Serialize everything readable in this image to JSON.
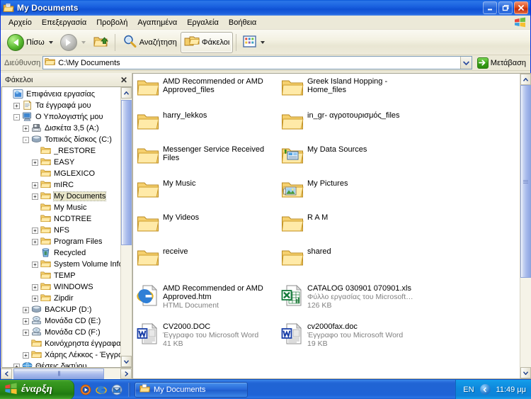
{
  "window": {
    "title": "My Documents",
    "icon": "folder-documents-icon",
    "buttons": {
      "minimize": "Ελαχιστοποίηση",
      "maximize": "Μεγιστοποίηση",
      "close": "Κλείσιμο"
    }
  },
  "menu": {
    "items": [
      {
        "label": "Αρχείο"
      },
      {
        "label": "Επεξεργασία"
      },
      {
        "label": "Προβολή"
      },
      {
        "label": "Αγαπημένα"
      },
      {
        "label": "Εργαλεία"
      },
      {
        "label": "Βοήθεια"
      }
    ],
    "flag_icon": "windows-flag-icon"
  },
  "toolbar": {
    "back_label": "Πίσω",
    "forward_label": "",
    "up_label": "",
    "search_label": "Αναζήτηση",
    "folders_label": "Φάκελοι",
    "views_label": ""
  },
  "address": {
    "label": "Διεύθυνση",
    "value": "C:\\My Documents",
    "go_label": "Μετάβαση"
  },
  "folders_pane": {
    "header": "Φάκελοι",
    "close_glyph": "✕",
    "tree": [
      {
        "label": "Επιφάνεια εργασίας",
        "indent": 0,
        "expander": "none",
        "icon": "desktop-icon",
        "selected": false
      },
      {
        "label": "Τα έγγραφά μου",
        "indent": 1,
        "expander": "+",
        "icon": "my-documents-icon",
        "selected": false
      },
      {
        "label": "Ο Υπολογιστής μου",
        "indent": 1,
        "expander": "-",
        "icon": "my-computer-icon",
        "selected": false
      },
      {
        "label": "Δισκέτα 3,5 (A:)",
        "indent": 2,
        "expander": "+",
        "icon": "floppy-icon",
        "selected": false
      },
      {
        "label": "Τοπικός δίσκος (C:)",
        "indent": 2,
        "expander": "-",
        "icon": "harddisk-icon",
        "selected": false
      },
      {
        "label": "_RESTORE",
        "indent": 3,
        "expander": "none",
        "icon": "folder-icon",
        "selected": false
      },
      {
        "label": "EASY",
        "indent": 3,
        "expander": "+",
        "icon": "folder-icon",
        "selected": false
      },
      {
        "label": "MGLEXICO",
        "indent": 3,
        "expander": "none",
        "icon": "folder-icon",
        "selected": false
      },
      {
        "label": "mIRC",
        "indent": 3,
        "expander": "+",
        "icon": "folder-icon",
        "selected": false
      },
      {
        "label": "My Documents",
        "indent": 3,
        "expander": "+",
        "icon": "folder-icon",
        "selected": true
      },
      {
        "label": "My Music",
        "indent": 3,
        "expander": "none",
        "icon": "folder-icon",
        "selected": false
      },
      {
        "label": "NCDTREE",
        "indent": 3,
        "expander": "none",
        "icon": "folder-icon",
        "selected": false
      },
      {
        "label": "NFS",
        "indent": 3,
        "expander": "+",
        "icon": "folder-icon",
        "selected": false
      },
      {
        "label": "Program Files",
        "indent": 3,
        "expander": "+",
        "icon": "folder-icon",
        "selected": false
      },
      {
        "label": "Recycled",
        "indent": 3,
        "expander": "none",
        "icon": "recycle-bin-icon",
        "selected": false
      },
      {
        "label": "System Volume Inform",
        "indent": 3,
        "expander": "+",
        "icon": "folder-icon",
        "selected": false
      },
      {
        "label": "TEMP",
        "indent": 3,
        "expander": "none",
        "icon": "folder-icon",
        "selected": false
      },
      {
        "label": "WINDOWS",
        "indent": 3,
        "expander": "+",
        "icon": "folder-icon",
        "selected": false
      },
      {
        "label": "Zipdir",
        "indent": 3,
        "expander": "+",
        "icon": "folder-icon",
        "selected": false
      },
      {
        "label": "BACKUP (D:)",
        "indent": 2,
        "expander": "+",
        "icon": "harddisk-icon",
        "selected": false
      },
      {
        "label": "Μονάδα CD (E:)",
        "indent": 2,
        "expander": "+",
        "icon": "cd-drive-icon",
        "selected": false
      },
      {
        "label": "Μονάδα CD (F:)",
        "indent": 2,
        "expander": "+",
        "icon": "cd-drive-icon",
        "selected": false
      },
      {
        "label": "Κοινόχρηστα έγγραφα",
        "indent": 2,
        "expander": "none",
        "icon": "folder-icon",
        "selected": false
      },
      {
        "label": "Χάρης Λέκκος - Έγγραφα",
        "indent": 2,
        "expander": "+",
        "icon": "folder-icon",
        "selected": false
      },
      {
        "label": "Θέσεις δικτύου",
        "indent": 1,
        "expander": "+",
        "icon": "network-icon",
        "selected": false
      }
    ]
  },
  "filelist": {
    "items": [
      {
        "name": "AMD Recommended or AMD Approved_files",
        "sub": "",
        "size": "",
        "icon": "folder-icon",
        "col": 0,
        "row": 0
      },
      {
        "name": "Greek Island Hopping - Home_files",
        "sub": "",
        "size": "",
        "icon": "folder-icon",
        "col": 1,
        "row": 0
      },
      {
        "name": "harry_lekkos",
        "sub": "",
        "size": "",
        "icon": "folder-icon",
        "col": 0,
        "row": 1
      },
      {
        "name": "in_gr- αγροτουρισμός_files",
        "sub": "",
        "size": "",
        "icon": "folder-icon",
        "col": 1,
        "row": 1
      },
      {
        "name": "Messenger Service Received Files",
        "sub": "",
        "size": "",
        "icon": "folder-icon",
        "col": 0,
        "row": 2
      },
      {
        "name": "My Data Sources",
        "sub": "",
        "size": "",
        "icon": "folder-datasources-icon",
        "col": 1,
        "row": 2
      },
      {
        "name": "My Music",
        "sub": "",
        "size": "",
        "icon": "folder-icon",
        "col": 0,
        "row": 3
      },
      {
        "name": "My Pictures",
        "sub": "",
        "size": "",
        "icon": "folder-pictures-icon",
        "col": 1,
        "row": 3
      },
      {
        "name": "My Videos",
        "sub": "",
        "size": "",
        "icon": "folder-icon",
        "col": 0,
        "row": 4
      },
      {
        "name": "R A M",
        "sub": "",
        "size": "",
        "icon": "folder-icon",
        "col": 1,
        "row": 4
      },
      {
        "name": "receive",
        "sub": "",
        "size": "",
        "icon": "folder-icon",
        "col": 0,
        "row": 5
      },
      {
        "name": "shared",
        "sub": "",
        "size": "",
        "icon": "folder-icon",
        "col": 1,
        "row": 5
      },
      {
        "name": "AMD Recommended or AMD Approved.htm",
        "sub": "HTML Document",
        "size": "",
        "icon": "html-document-icon",
        "col": 0,
        "row": 6
      },
      {
        "name": "CATALOG 030901 070901.xls",
        "sub": "Φύλλο εργασίας του Microsoft…",
        "size": "126 KB",
        "icon": "excel-document-icon",
        "col": 1,
        "row": 6
      },
      {
        "name": "CV2000.DOC",
        "sub": "Έγγραφο του Microsoft Word",
        "size": "41 KB",
        "icon": "word-document-icon",
        "col": 0,
        "row": 7
      },
      {
        "name": "cv2000fax.doc",
        "sub": "Έγγραφο του Microsoft Word",
        "size": "19 KB",
        "icon": "word-document-icon",
        "col": 1,
        "row": 7
      }
    ]
  },
  "taskbar": {
    "start_label": "έναρξη",
    "quicklaunch": [
      {
        "icon": "media-player-icon"
      },
      {
        "icon": "internet-explorer-icon"
      },
      {
        "icon": "outlook-express-icon"
      }
    ],
    "tasks": [
      {
        "label": "My Documents",
        "icon": "folder-documents-icon",
        "active": true
      }
    ],
    "tray": {
      "language": "EN",
      "clock": "11:49 μμ",
      "chevron_icon": "tray-chevron-icon"
    }
  },
  "colors": {
    "title_blue": "#0f51d4",
    "face": "#ece9d8",
    "folder_yellow": "#fbe396",
    "taskbar_blue": "#2064d4",
    "start_green": "#2e8c18",
    "selection": "#e8e5c8"
  }
}
